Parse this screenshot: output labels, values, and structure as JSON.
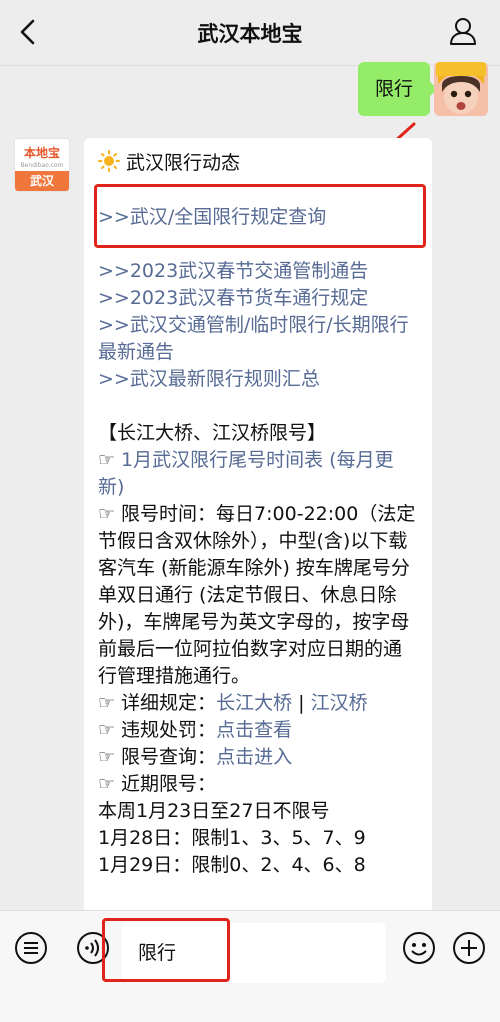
{
  "header": {
    "title": "武汉本地宝"
  },
  "outgoing": {
    "text": "限行"
  },
  "bot_avatar": {
    "brand": "本地宝",
    "sub": "Bendibao.com",
    "city": "武汉"
  },
  "message": {
    "heading": "武汉限行动态",
    "links_top": [
      ">>武汉/全国限行规定查询"
    ],
    "links": [
      ">>2023武汉春节交通管制通告",
      ">>2023武汉春节货车通行规定",
      ">>武汉交通管制/临时限行/长期限行最新通告",
      ">>武汉最新限行规则汇总"
    ],
    "section_title": "【长江大桥、江汉桥限号】",
    "tail_table_link": "1月武汉限行尾号时间表 (每月更新)",
    "rule_text": "限号时间：每日7:00-22:00（法定节假日含双休除外），中型(含)以下载客汽车 (新能源车除外) 按车牌尾号分单双日通行 (法定节假日、休息日除外)，车牌尾号为英文字母的，按字母前最后一位阿拉伯数字对应日期的通行管理措施通行。",
    "detail_label": "详细规定：",
    "detail_link_1": "长江大桥",
    "detail_sep": " | ",
    "detail_link_2": "江汉桥",
    "violation_label": "违规处罚：",
    "violation_link": "点击查看",
    "query_label": "限号查询：",
    "query_link": "点击进入",
    "recent_label": "近期限号：",
    "recent_lines": [
      "本周1月23日至27日不限号",
      "1月28日：限制1、3、5、7、9",
      "1月29日：限制0、2、4、6、8"
    ]
  },
  "input": {
    "value": "限行"
  }
}
